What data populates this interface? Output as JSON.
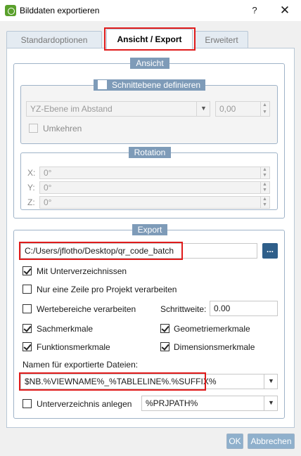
{
  "window": {
    "title": "Bilddaten exportieren",
    "help": "?",
    "close": "✕"
  },
  "tabs": [
    {
      "label": "Standardoptionen"
    },
    {
      "label": "Ansicht / Export"
    },
    {
      "label": "Erweitert"
    }
  ],
  "ansicht": {
    "title": "Ansicht",
    "schnittebene": {
      "label": "Schnittebene definieren",
      "select_value": "YZ-Ebene im Abstand",
      "distance_value": "0,00",
      "umkehren_label": "Umkehren"
    },
    "rotation": {
      "title": "Rotation",
      "x_label": "X:",
      "x_value": "0°",
      "y_label": "Y:",
      "y_value": "0°",
      "z_label": "Z:",
      "z_value": "0°"
    }
  },
  "export": {
    "title": "Export",
    "path_value": "C:/Users/jflotho/Desktop/qr_code_batch",
    "browse_label": "...",
    "mit_unterverzeichnissen": "Mit Unterverzeichnissen",
    "nur_eine_zeile": "Nur eine Zeile pro Projekt verarbeiten",
    "wertebereiche": "Wertebereiche verarbeiten",
    "schrittweite_label": "Schrittweite:",
    "schrittweite_value": "0.00",
    "sachmerkmale": "Sachmerkmale",
    "geometriemerkmale": "Geometriemerkmale",
    "funktionsmerkmale": "Funktionsmerkmale",
    "dimensionsmerkmale": "Dimensionsmerkmale",
    "namen_label": "Namen für exportierte Dateien:",
    "namen_value": "$NB.%VIEWNAME%_%TABLELINE%.%SUFFIX%",
    "unterverzeichnis_label": "Unterverzeichnis anlegen",
    "unterverzeichnis_value": "%PRJPATH%"
  },
  "footer": {
    "ok_label": "OK",
    "cancel_label": "Abbrechen"
  }
}
